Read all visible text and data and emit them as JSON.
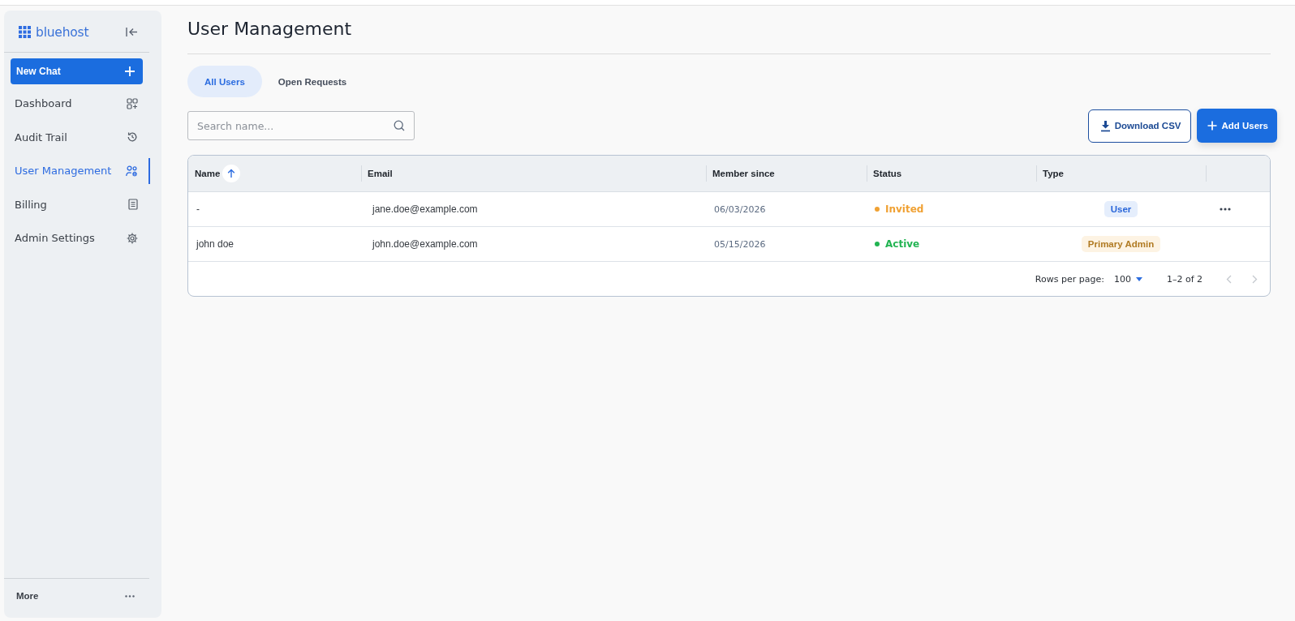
{
  "sidebar": {
    "logo": "bluehost",
    "new_chat": "New Chat",
    "items": [
      {
        "label": "Dashboard",
        "selected": false
      },
      {
        "label": "Audit Trail",
        "selected": false
      },
      {
        "label": "User Management",
        "selected": true
      },
      {
        "label": "Billing",
        "selected": false
      },
      {
        "label": "Admin Settings",
        "selected": false
      }
    ],
    "more": "More"
  },
  "page": {
    "title": "User Management"
  },
  "tabs": [
    {
      "label": "All Users",
      "selected": true
    },
    {
      "label": "Open Requests",
      "selected": false
    }
  ],
  "search": {
    "placeholder": "Search name..."
  },
  "buttons": [
    {
      "label": "Download CSV",
      "kind": "outline"
    },
    {
      "label": "Add Users",
      "kind": "primary"
    }
  ],
  "table": {
    "columns": [
      {
        "label": "Name",
        "sorted": true
      },
      {
        "label": "Email",
        "sorted": false
      },
      {
        "label": "Member since",
        "sorted": false
      },
      {
        "label": "Status",
        "sorted": false
      },
      {
        "label": "Type",
        "sorted": false
      }
    ],
    "rows": [
      {
        "name": "-",
        "email": "jane.doe@example.com",
        "member_since": "06/03/2026",
        "status": {
          "label": "Invited",
          "color": "#f0a133"
        },
        "type": {
          "label": "User",
          "kind": "user"
        },
        "menu": true
      },
      {
        "name": "john doe",
        "email": "john.doe@example.com",
        "member_since": "05/15/2026",
        "status": {
          "label": "Active",
          "color": "#22b452"
        },
        "type": {
          "label": "Primary Admin",
          "kind": "primary_admin"
        },
        "menu": false
      }
    ]
  },
  "pagination": {
    "rows_per_page_label": "Rows per page:",
    "rows_per_page": "100",
    "range": "1–2 of 2",
    "previous_disabled": true,
    "next_disabled": true
  }
}
